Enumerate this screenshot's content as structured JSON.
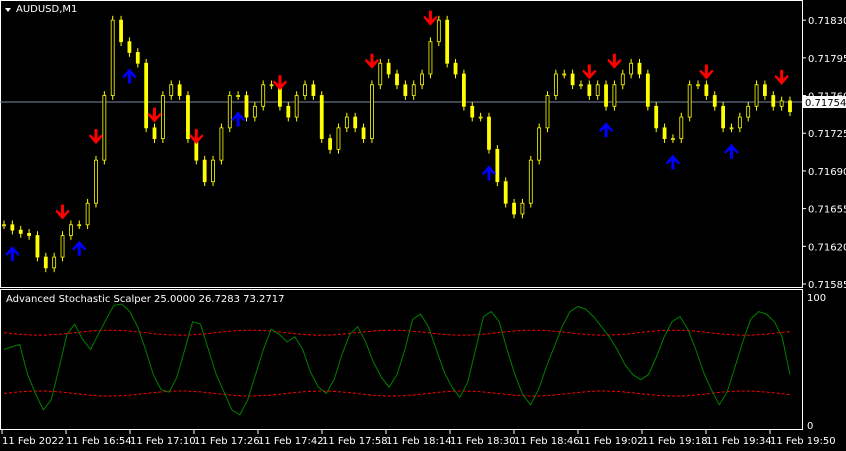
{
  "window": {
    "symbol_label": "AUDUSD,M1",
    "menu_icon": "triangle-down-icon"
  },
  "indicator": {
    "label": "Advanced Stochastic Scalper 25.0000 26.7283 73.2717",
    "scale_top": "100",
    "scale_bottom": "0"
  },
  "colors": {
    "background": "#000000",
    "candle": "#ffff00",
    "frame": "#ffffff",
    "price_line": "#7b8aa8",
    "sell_arrow": "#ff0000",
    "buy_arrow": "#0000ff",
    "stoch_line": "#008000",
    "bands": "#ff0000"
  },
  "price_axis": {
    "ticks": [
      "0.71830",
      "0.71795",
      "0.71760",
      "0.71725",
      "0.71690",
      "0.71655",
      "0.71620",
      "0.71585"
    ],
    "current_price": "0.71754"
  },
  "time_axis": {
    "labels": [
      "11 Feb 2022",
      "11 Feb 16:54",
      "11 Feb 17:10",
      "11 Feb 17:26",
      "11 Feb 17:42",
      "11 Feb 17:58",
      "11 Feb 18:14",
      "11 Feb 18:30",
      "11 Feb 18:46",
      "11 Feb 19:02",
      "11 Feb 19:18",
      "11 Feb 19:34",
      "11 Feb 19:50"
    ]
  },
  "chart_data": [
    {
      "type": "line",
      "name": "AUDUSD,M1",
      "x": [
        "16:38",
        "16:40",
        "16:42",
        "16:44",
        "16:46",
        "16:48",
        "16:50",
        "16:52",
        "16:54",
        "16:56",
        "16:58",
        "17:00",
        "17:02",
        "17:04",
        "17:06",
        "17:08",
        "17:10",
        "17:12",
        "17:14",
        "17:16",
        "17:18",
        "17:20",
        "17:22",
        "17:24",
        "17:26",
        "17:28",
        "17:30",
        "17:32",
        "17:34",
        "17:36",
        "17:38",
        "17:40",
        "17:42",
        "17:44",
        "17:46",
        "17:48",
        "17:50",
        "17:52",
        "17:54",
        "17:56",
        "17:58",
        "18:00",
        "18:02",
        "18:04",
        "18:06",
        "18:08",
        "18:10",
        "18:12",
        "18:14",
        "18:16",
        "18:18",
        "18:20",
        "18:22",
        "18:24",
        "18:26",
        "18:28",
        "18:30",
        "18:32",
        "18:34",
        "18:36",
        "18:38",
        "18:40",
        "18:42",
        "18:44",
        "18:46",
        "18:48",
        "18:50",
        "18:52",
        "18:54",
        "18:56",
        "18:58",
        "19:00",
        "19:02",
        "19:04",
        "19:06",
        "19:08",
        "19:10",
        "19:12",
        "19:14",
        "19:16",
        "19:18",
        "19:20",
        "19:22",
        "19:24",
        "19:26",
        "19:28",
        "19:30",
        "19:32",
        "19:34",
        "19:36",
        "19:38",
        "19:40",
        "19:42",
        "19:44",
        "19:46",
        "19:48",
        "19:50",
        "19:52",
        "19:54",
        "19:56",
        "19:58"
      ],
      "y": [
        0.7164,
        0.71635,
        0.71632,
        0.7163,
        0.7161,
        0.716,
        0.7161,
        0.7163,
        0.7164,
        0.7164,
        0.7166,
        0.717,
        0.7176,
        0.7183,
        0.7181,
        0.718,
        0.7179,
        0.7173,
        0.7172,
        0.7176,
        0.7177,
        0.7176,
        0.7172,
        0.717,
        0.7168,
        0.717,
        0.7173,
        0.7176,
        0.7176,
        0.7174,
        0.7175,
        0.7177,
        0.7177,
        0.7175,
        0.7174,
        0.7176,
        0.7177,
        0.7176,
        0.7172,
        0.7171,
        0.7173,
        0.7174,
        0.7173,
        0.7172,
        0.7177,
        0.7179,
        0.7178,
        0.7177,
        0.7176,
        0.7177,
        0.7178,
        0.7181,
        0.7183,
        0.7179,
        0.7178,
        0.7175,
        0.7174,
        0.7174,
        0.7171,
        0.7168,
        0.7166,
        0.7165,
        0.7166,
        0.717,
        0.7173,
        0.7176,
        0.7178,
        0.7178,
        0.7177,
        0.7177,
        0.7176,
        0.7177,
        0.7175,
        0.7177,
        0.7178,
        0.7179,
        0.7178,
        0.7175,
        0.7173,
        0.7172,
        0.7172,
        0.7174,
        0.7177,
        0.7177,
        0.7176,
        0.7175,
        0.7173,
        0.7173,
        0.7174,
        0.7175,
        0.7177,
        0.7176,
        0.7175,
        0.71755,
        0.71745
      ],
      "ylim": [
        0.71585,
        0.71845
      ],
      "sell_signals": [
        "16:52",
        "17:00",
        "17:14",
        "17:24",
        "17:44",
        "18:06",
        "18:20",
        "18:58",
        "19:04",
        "19:26",
        "19:44"
      ],
      "buy_signals": [
        "16:40",
        "16:56",
        "17:08",
        "17:34",
        "18:34",
        "19:02",
        "19:18",
        "19:32"
      ],
      "current_price": 0.71754
    },
    {
      "type": "line",
      "name": "Advanced Stochastic Scalper",
      "ylim": [
        0,
        100
      ],
      "levels": [
        25.0,
        26.7283,
        73.2717
      ],
      "values": [
        60,
        62,
        64,
        40,
        25,
        12,
        20,
        45,
        72,
        80,
        68,
        60,
        72,
        84,
        95,
        96,
        90,
        78,
        60,
        40,
        28,
        26,
        38,
        60,
        82,
        80,
        60,
        40,
        26,
        12,
        8,
        20,
        40,
        60,
        76,
        72,
        66,
        70,
        60,
        42,
        30,
        25,
        36,
        56,
        72,
        78,
        66,
        50,
        38,
        30,
        40,
        60,
        84,
        88,
        78,
        60,
        42,
        30,
        22,
        34,
        60,
        86,
        90,
        82,
        60,
        40,
        24,
        16,
        28,
        46,
        62,
        78,
        90,
        94,
        92,
        86,
        78,
        70,
        60,
        48,
        40,
        36,
        40,
        54,
        70,
        82,
        86,
        76,
        60,
        42,
        28,
        16,
        26,
        46,
        66,
        84,
        90,
        88,
        82,
        70,
        40
      ]
    }
  ]
}
